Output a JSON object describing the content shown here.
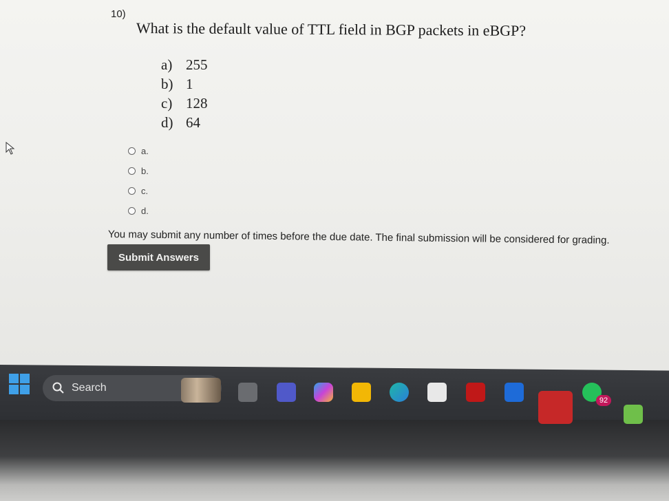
{
  "question": {
    "number": "10)",
    "text": "What is the default value of TTL field in BGP packets in eBGP?",
    "options": [
      {
        "letter": "a)",
        "value": "255"
      },
      {
        "letter": "b)",
        "value": "1"
      },
      {
        "letter": "c)",
        "value": "128"
      },
      {
        "letter": "d)",
        "value": "64"
      }
    ]
  },
  "answers": {
    "choices": [
      "a.",
      "b.",
      "c.",
      "d."
    ]
  },
  "notice": "You may submit any number of times before the due date. The final submission will be considered for grading.",
  "submit_label": "Submit Answers",
  "taskbar": {
    "search_label": "Search",
    "icons": [
      "windows-start-icon",
      "task-view-icon",
      "teams-icon",
      "copilot-icon",
      "file-explorer-icon",
      "edge-icon",
      "microsoft-store-icon",
      "mcafee-icon",
      "dropbox-icon",
      "opera-icon",
      "whatsapp-icon",
      "photos-icon"
    ],
    "whatsapp_badge": "92"
  },
  "colors": {
    "submit_bg": "#4a4a48",
    "taskbar_bg": "#34363a",
    "badge": "#c2185b"
  }
}
